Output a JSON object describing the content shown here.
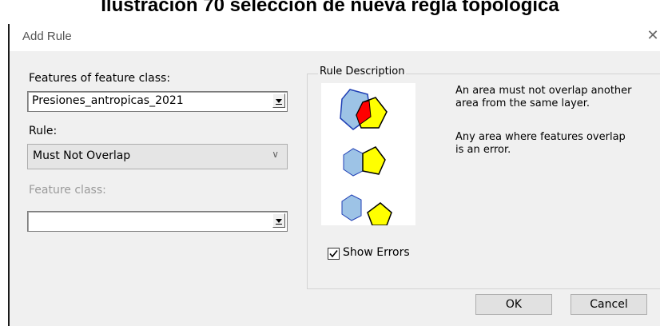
{
  "caption": "Ilustración 70 selección de nueva regla topológica",
  "dialog": {
    "title": "Add Rule",
    "close_icon": "close-icon"
  },
  "form": {
    "features_label": "Features of feature class:",
    "features_value": "Presiones_antropicas_2021",
    "rule_label": "Rule:",
    "rule_value": "Must Not Overlap",
    "feature_class_label": "Feature class:",
    "feature_class_value": ""
  },
  "description": {
    "group_label": "Rule Description",
    "text1_line1": "An area must not overlap another",
    "text1_line2": "area from the same layer.",
    "text2_line1": "Any area where features overlap",
    "text2_line2": "is an error."
  },
  "show_errors": {
    "label": "Show Errors",
    "checked": true
  },
  "buttons": {
    "ok": "OK",
    "cancel": "Cancel"
  },
  "colors": {
    "polygon_blue": "#9dc3e6",
    "polygon_yellow": "#ffff00",
    "overlap_red": "#ff0000",
    "polygon_stroke": "#1f3fb5"
  }
}
